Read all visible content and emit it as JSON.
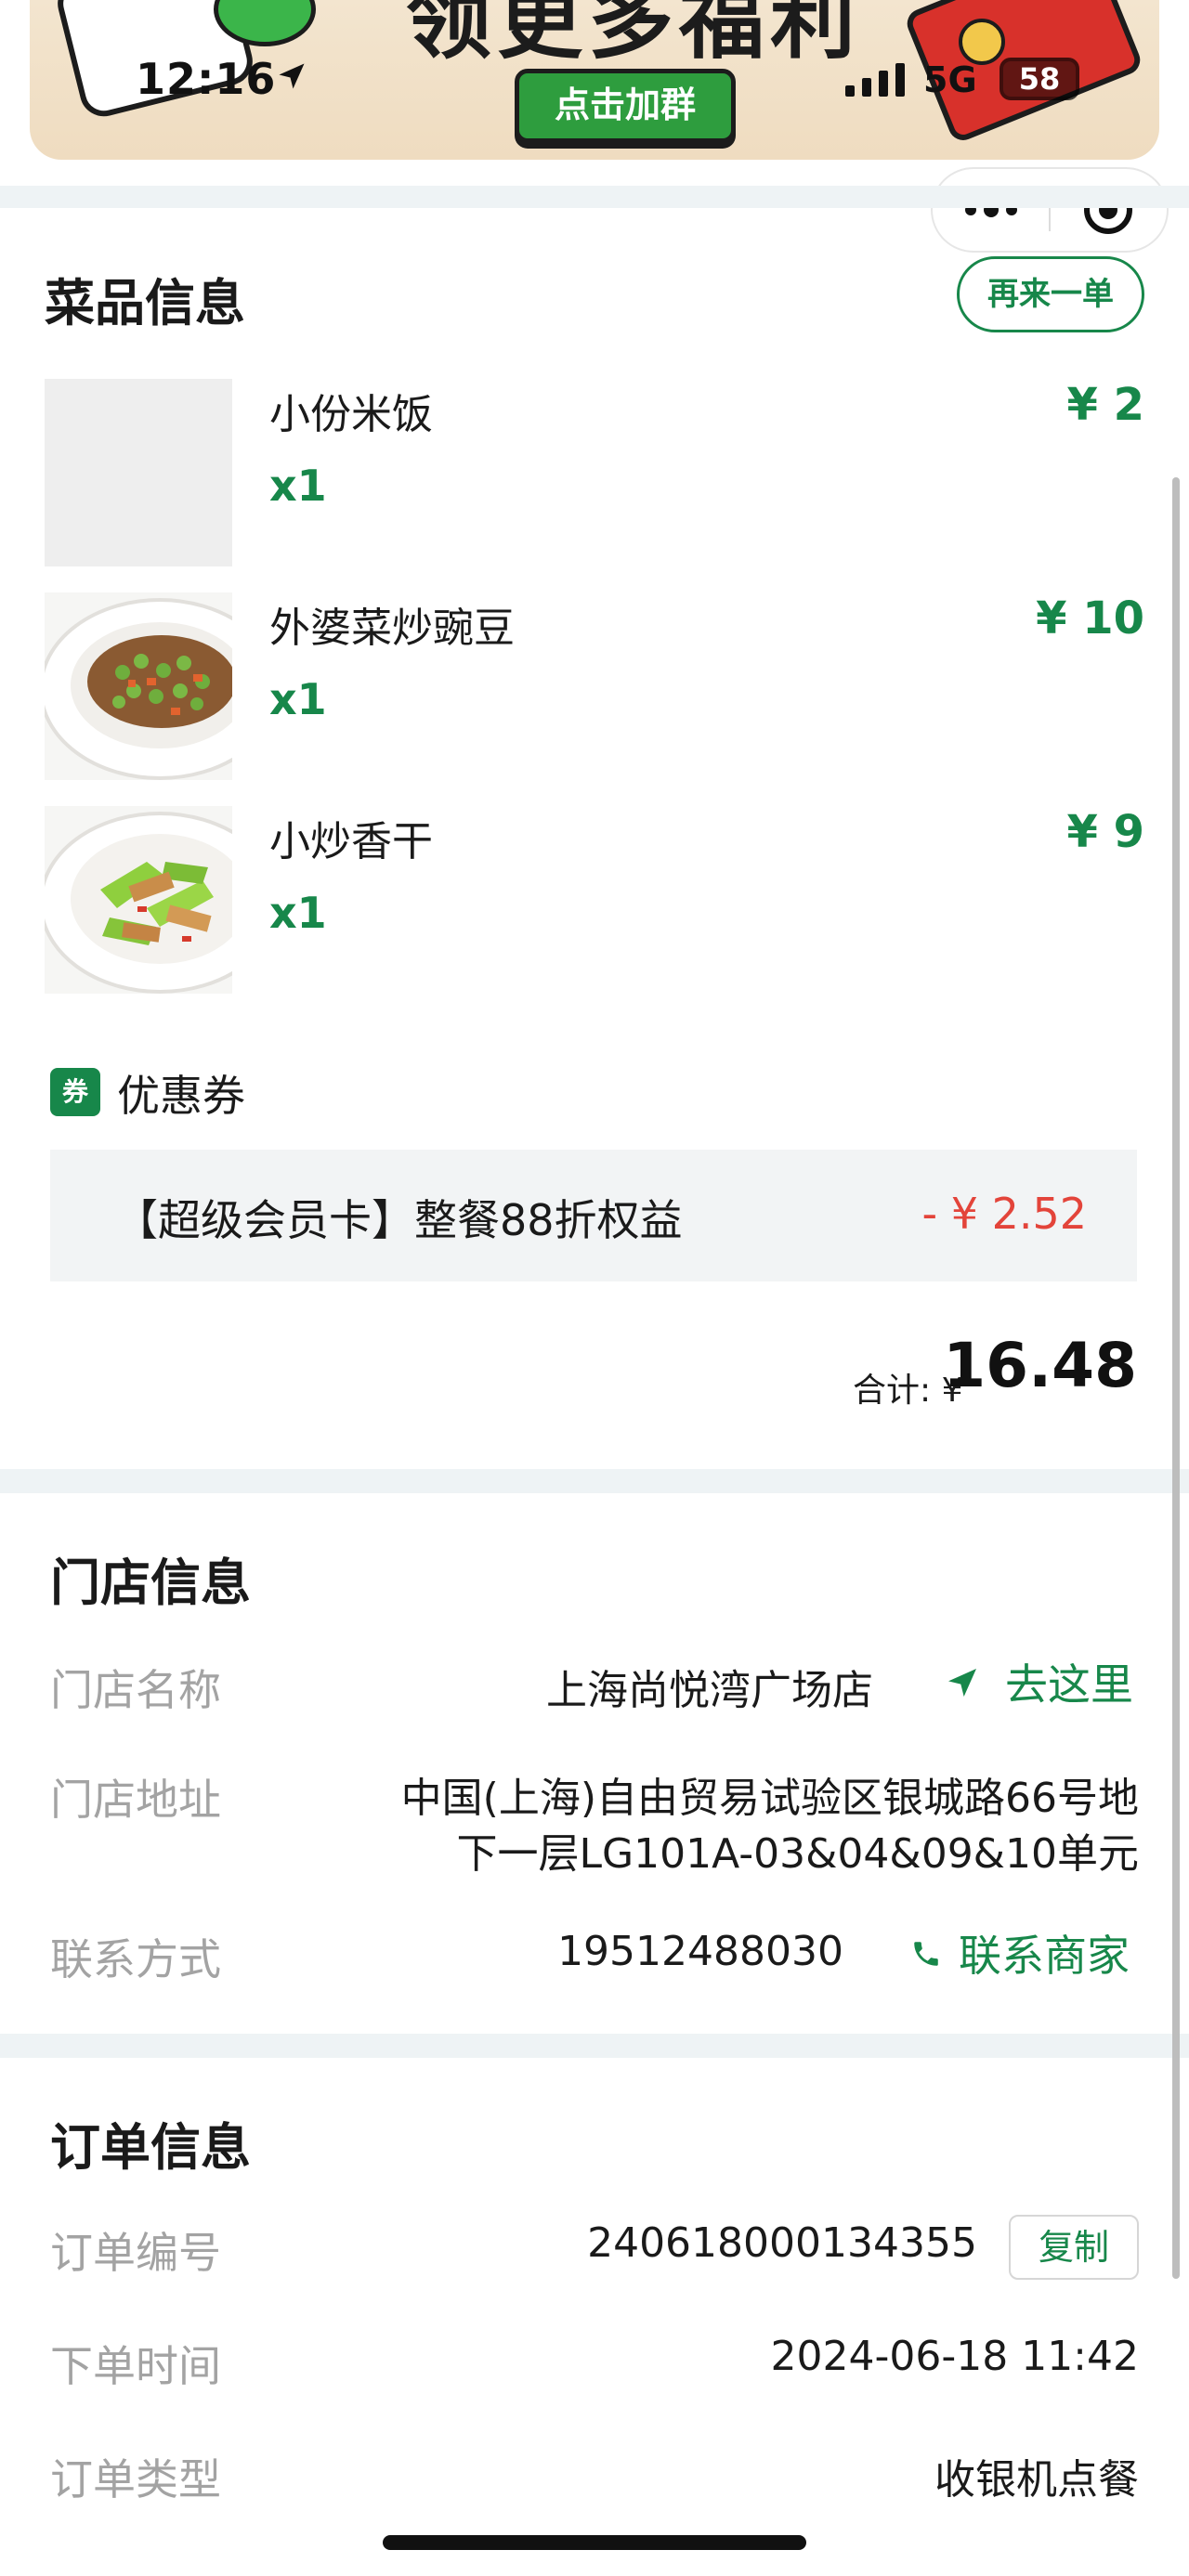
{
  "banner": {
    "headline": "领更多福利",
    "cta_label": "点击加群"
  },
  "status_bar": {
    "time": "12:16",
    "network": "5G",
    "battery": "58"
  },
  "header": {
    "section_title": "菜品信息",
    "reorder_label": "再来一单"
  },
  "dishes": [
    {
      "name": "小份米饭",
      "qty": "x1",
      "price": "¥ 2"
    },
    {
      "name": "外婆菜炒豌豆",
      "qty": "x1",
      "price": "¥ 10"
    },
    {
      "name": "小炒香干",
      "qty": "x1",
      "price": "¥ 9"
    }
  ],
  "coupon": {
    "tag": "券",
    "label": "优惠券",
    "name": "【超级会员卡】整餐88折权益",
    "value": "- ¥ 2.52"
  },
  "total": {
    "label": "合计: ¥",
    "value": "16.48"
  },
  "store": {
    "section_title": "门店信息",
    "name_key": "门店名称",
    "name_value": "上海尚悦湾广场店",
    "go_label": "去这里",
    "address_key": "门店地址",
    "address_line1": "中国(上海)自由贸易试验区银城路66号地",
    "address_line2": "下一层LG101A-03&04&09&10单元",
    "contact_key": "联系方式",
    "contact_value": "19512488030",
    "contact_label": "联系商家"
  },
  "order": {
    "section_title": "订单信息",
    "number_key": "订单编号",
    "number_value": "240618000134355",
    "copy_label": "复制",
    "time_key": "下单时间",
    "time_value": "2024-06-18 11:42",
    "type_key": "订单类型",
    "type_value": "收银机点餐"
  },
  "colors": {
    "accent": "#17874a",
    "discount": "#e3443a",
    "separator": "#eef3f5"
  }
}
